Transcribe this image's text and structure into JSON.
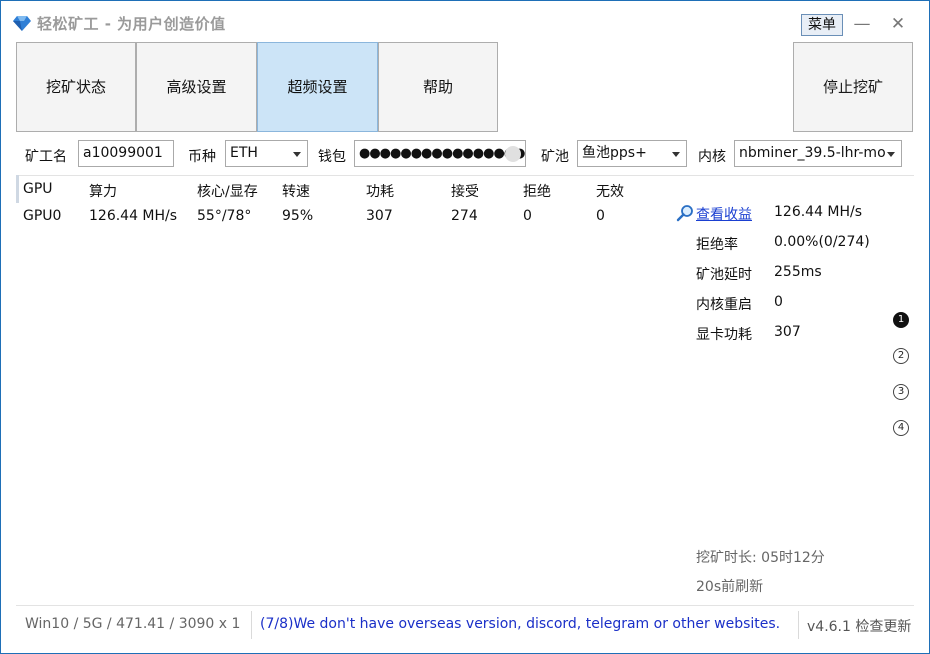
{
  "window": {
    "title": "轻松矿工 - 为用户创造价值",
    "menu_label": "菜单",
    "minimize_glyph": "—",
    "close_glyph": "✕"
  },
  "tabs": [
    {
      "label": "挖矿状态"
    },
    {
      "label": "高级设置"
    },
    {
      "label": "超频设置",
      "active": true
    },
    {
      "label": "帮助"
    }
  ],
  "stop_button": "停止挖矿",
  "config": {
    "miner_name_label": "矿工名",
    "miner_name_value": "a10099001",
    "coin_label": "币种",
    "coin_value": "ETH",
    "wallet_label": "钱包",
    "wallet_value": "●●●●●●●●●●●●●●●●●●●",
    "pool_label": "矿池",
    "pool_value": "鱼池pps+",
    "kernel_label": "内核",
    "kernel_value": "nbminer_39.5-lhr-mo"
  },
  "gpu_table": {
    "headers": [
      "GPU",
      "算力",
      "核心/显存",
      "转速",
      "功耗",
      "接受",
      "拒绝",
      "无效"
    ],
    "rows": [
      [
        "GPU0",
        "126.44 MH/s",
        "55°/78°",
        "95%",
        "307",
        "274",
        "0",
        "0"
      ]
    ]
  },
  "summary": {
    "profit_link": "查看收益",
    "hashrate": "126.44 MH/s",
    "reject_rate_label": "拒绝率",
    "reject_rate_value": "0.00%(0/274)",
    "pool_latency_label": "矿池延时",
    "pool_latency_value": "255ms",
    "kernel_restart_label": "内核重启",
    "kernel_restart_value": "0",
    "gpu_power_label": "显卡功耗",
    "gpu_power_value": "307"
  },
  "pager": [
    "1",
    "2",
    "3",
    "4"
  ],
  "mining_time": "挖矿时长:  05时12分",
  "refresh_note": "20s前刷新",
  "statusbar": {
    "system": "Win10  / 5G / 471.41 / 3090 x 1",
    "message": "(7/8)We don't have overseas version, discord, telegram or other websites.",
    "version": "v4.6.1 检查更新"
  },
  "colors": {
    "accent": "#cce4f7",
    "link": "#1a3fd1",
    "status_message": "#1a2fc8"
  }
}
